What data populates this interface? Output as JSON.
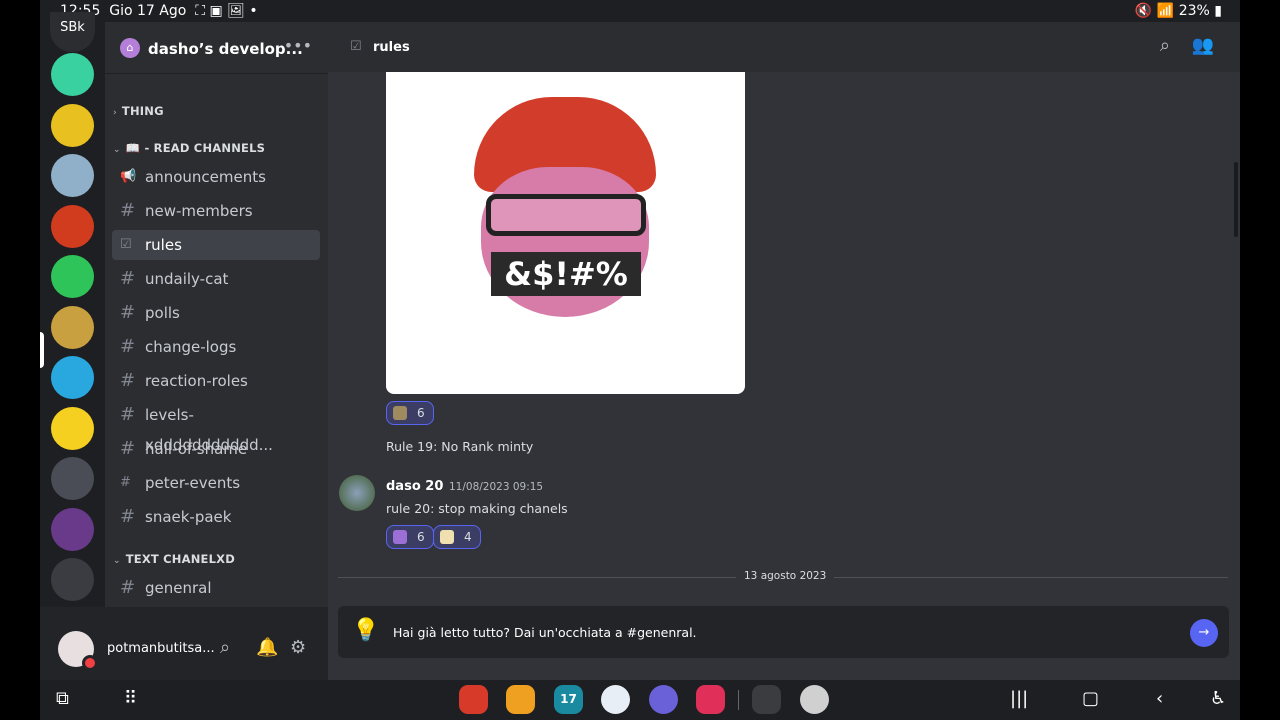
{
  "status_bar": {
    "time": "12:55",
    "date": "Gio 17 Ago",
    "indicators": "⛶ ▣ 🖼 •",
    "battery": "23%"
  },
  "rail": {
    "top_label": "SBk",
    "servers": [
      "#3ad1a0",
      "#e8c020",
      "#8fb0c8",
      "#d23c1e",
      "#2fc45a",
      "#c8a040",
      "#29a8e0",
      "#f5d020",
      "#4a4d55",
      "#6a3a8a",
      "#3a3c42"
    ]
  },
  "server": {
    "name": "dasho’s develop...",
    "menu_icon": "more-icon"
  },
  "categories": {
    "thing": "THING",
    "read": "📖 - READ CHANNELS",
    "text": "TEXT CHANELXD"
  },
  "channels": [
    {
      "name": "announcements",
      "icon": "megaphone-icon"
    },
    {
      "name": "new-members",
      "icon": "hash-icon"
    },
    {
      "name": "rules",
      "icon": "rules-icon",
      "selected": true
    },
    {
      "name": "undaily-cat",
      "icon": "hash-icon"
    },
    {
      "name": "polls",
      "icon": "hash-icon"
    },
    {
      "name": "change-logs",
      "icon": "hash-icon"
    },
    {
      "name": "reaction-roles",
      "icon": "hash-icon"
    },
    {
      "name": "levels-xddddddddddd...",
      "icon": "hash-icon"
    },
    {
      "name": "hall-of-shame",
      "icon": "hash-icon"
    },
    {
      "name": "peter-events",
      "icon": "hash-lock-icon"
    },
    {
      "name": "snaek-paek",
      "icon": "hash-icon"
    }
  ],
  "text_channels": [
    {
      "name": "genenral"
    }
  ],
  "user": {
    "name": "potmanbutitsa...",
    "status": "dnd"
  },
  "header": {
    "channel": "rules"
  },
  "image": {
    "caption": "&$!#%"
  },
  "messages": [
    {
      "reactions": [
        {
          "count": "6",
          "color": "#a08a60"
        }
      ]
    },
    {
      "text": "Rule 19: No Rank minty"
    },
    {
      "author": "daso 20",
      "timestamp": "11/08/2023 09:15",
      "text": "rule 20: stop making chanels",
      "reactions": [
        {
          "count": "6",
          "color": "#9b6fd6"
        },
        {
          "count": "4",
          "color": "#f0e0b0"
        }
      ]
    }
  ],
  "date_divider": "13 agosto 2023",
  "banner": {
    "text": "Hai già letto tutto? Dai un'occhiata a #genenral."
  },
  "accent": "#5865f2",
  "taskbar": {
    "apps": [
      {
        "name": "notes",
        "color": "#d83a2a"
      },
      {
        "name": "files",
        "color": "#f0a020"
      },
      {
        "name": "calendar",
        "color": "#1a8aa0",
        "label": "17"
      },
      {
        "name": "messages",
        "color": "#e8eef5"
      },
      {
        "name": "internet",
        "color": "#6a60d8"
      },
      {
        "name": "screen-recorder",
        "color": "#e0305a"
      },
      {
        "name": "roblox",
        "color": "#3a3c40"
      },
      {
        "name": "other",
        "color": "#d0d0d0"
      }
    ]
  }
}
